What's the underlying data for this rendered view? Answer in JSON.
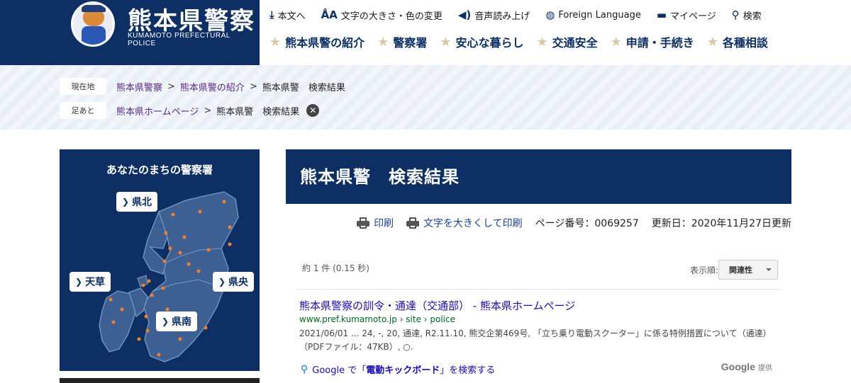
{
  "header": {
    "title": "熊本県警察",
    "subtitle": "KUMAMOTO PREFECTURAL POLICE"
  },
  "util_nav": [
    {
      "label": "本文へ",
      "icon": "download-arrow-icon"
    },
    {
      "label": "文字の大きさ・色の変更",
      "icon": "text-size-icon"
    },
    {
      "label": "音声読み上げ",
      "icon": "speaker-icon"
    },
    {
      "label": "Foreign Language",
      "icon": "globe-icon"
    },
    {
      "label": "マイページ",
      "icon": "folder-icon"
    },
    {
      "label": "検索",
      "icon": "search-icon"
    }
  ],
  "main_nav": [
    {
      "label": "熊本県警の紹介"
    },
    {
      "label": "警察署"
    },
    {
      "label": "安心な暮らし"
    },
    {
      "label": "交通安全"
    },
    {
      "label": "申請・手続き"
    },
    {
      "label": "各種相談"
    }
  ],
  "breadcrumb": {
    "current_label": "現在地",
    "current_links": [
      "熊本県警察",
      "熊本県警の紹介"
    ],
    "current_page": "熊本県警　検索結果",
    "history_label": "足あと",
    "history_links": [
      "熊本県ホームページ"
    ],
    "history_page": "熊本県警　検索結果"
  },
  "map": {
    "title": "あなたのまちの警察署",
    "regions": [
      "県北",
      "天草",
      "県央",
      "県南"
    ],
    "accent": "#f0812b",
    "land_color": "#3d5f92"
  },
  "page": {
    "title": "熊本県警　検索結果",
    "print_label": "印刷",
    "print_large_label": "文字を大きくして印刷",
    "page_number": "ページ番号：0069257",
    "updated": "更新日：2020年11月27日更新"
  },
  "results": {
    "count": "約 1 件 (0.15 秒)",
    "sort_label": "表示順:",
    "sort_value": "関連性",
    "items": [
      {
        "title": "熊本県警察の訓令・通達（交通部） - 熊本県ホームページ",
        "url": "www.pref.kumamoto.jp › site › police",
        "snippet": "2021/06/01 ... 24, -, 20, 通達, R2.11.10, 熊交企第469号, 「立ち乗り電動スクーター」に係る特例措置について（通達）（PDFファイル：47KB）, ○."
      }
    ],
    "google_search_prefix": "Google で「",
    "google_search_term": "電動キックボード",
    "google_search_suffix": "」を検索する",
    "powered_google": "Google",
    "powered_label": "提供"
  }
}
